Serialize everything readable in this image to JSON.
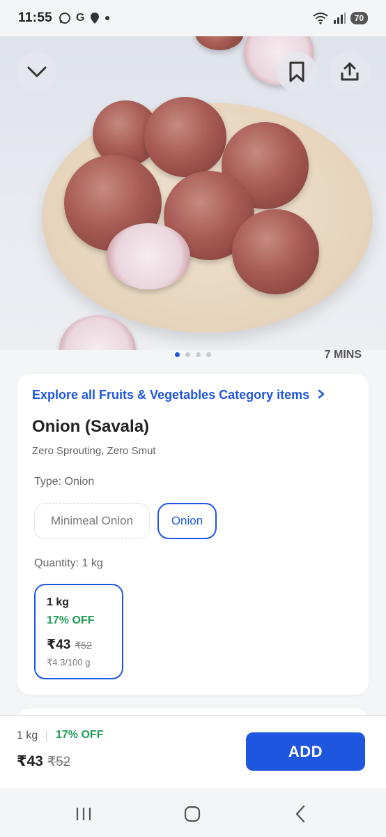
{
  "status_bar": {
    "time": "11:55",
    "left_icons": [
      "whatsapp-icon",
      "google-icon",
      "location-icon",
      "dot-icon"
    ],
    "right_icons": [
      "wifi-icon",
      "signal-icon",
      "battery-icon"
    ],
    "battery": "70"
  },
  "hero": {
    "carousel_total": 4,
    "carousel_active": 1,
    "eta": "7 MINS"
  },
  "product": {
    "explore_link": "Explore all Fruits & Vegetables Category items",
    "title": "Onion (Savala)",
    "subtitle": "Zero Sprouting, Zero Smut",
    "type_label": "Type: Onion",
    "types": [
      "Minimeal Onion",
      "Onion"
    ],
    "selected_type": "Onion",
    "quantity_label": "Quantity: 1 kg",
    "variant": {
      "size": "1 kg",
      "discount": "17% OFF",
      "price": "₹43",
      "mrp": "₹52",
      "unit_price": "₹4.3/100 g"
    }
  },
  "bottom_bar": {
    "size": "1 kg",
    "discount": "17% OFF",
    "price": "₹43",
    "mrp": "₹52",
    "add_label": "ADD"
  },
  "colors": {
    "accent": "#1f56e0",
    "discount_green": "#1f9d55",
    "background": "#f4f5f7"
  }
}
